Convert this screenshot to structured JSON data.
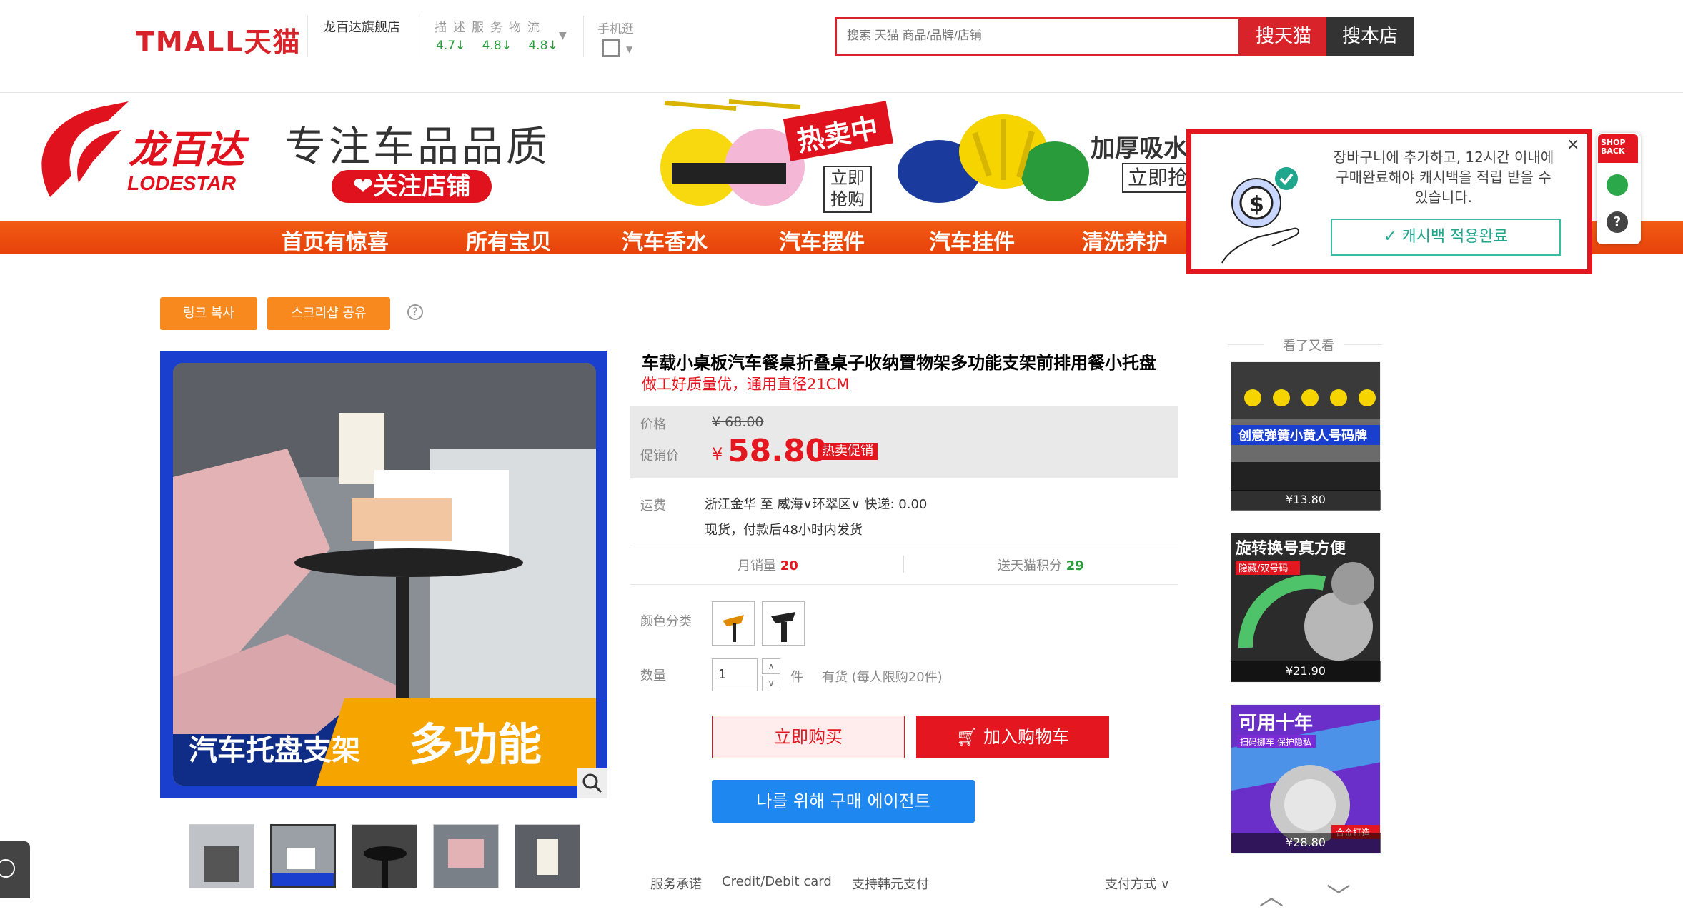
{
  "header": {
    "logo": "TMALL天猫",
    "shop_name": "龙百达旗舰店",
    "score_labels": "描述服务物流",
    "scores": "4.7↓ 4.8↓ 4.8↓",
    "mobile_label": "手机逛",
    "search_placeholder": "搜索 天猫 商品/品牌/店铺",
    "search_tmall": "搜天猫",
    "search_shop": "搜本店"
  },
  "banner": {
    "brand_cn": "龙百达",
    "brand_en": "LODESTAR",
    "slogan": "专注车品品质",
    "follow": "❤关注店铺",
    "hot_sale": "热卖中",
    "buy_now": "立即抢购",
    "thick_text": "加厚吸水",
    "buy_now_2": "立即抢"
  },
  "nav": [
    "首页有惊喜",
    "所有宝贝",
    "汽车香水",
    "汽车摆件",
    "汽车挂件",
    "清洗养护"
  ],
  "cashback": {
    "message": "장바구니에 추가하고, 12시간 이내에 구매완료해야 캐시백을 적립 받을 수 있습니다.",
    "button": "캐시백 적용완료",
    "close": "×",
    "badge": "SHOP BACK"
  },
  "actions": {
    "copy_link": "링크 복사",
    "share_screenshot": "스크리샵 공유"
  },
  "gallery": {
    "overlay_left": "汽车托盘支架",
    "overlay_right": "多功能",
    "thumbs": 5
  },
  "product": {
    "title": "车载小桌板汽车餐桌折叠桌子收纳置物架多功能支架前排用餐小托盘",
    "subtitle": "做工好质量优，通用直径21CM",
    "price_label": "价格",
    "old_price": "¥ 68.00",
    "promo_label": "促销价",
    "currency": "¥",
    "promo_price": "58.80",
    "promo_tag": "热卖促销",
    "ship_label": "运费",
    "ship_text": "浙江金华 至 威海∨环翠区∨ 快递: 0.00",
    "stock_text": "现货，付款后48小时内发货",
    "sales_label": "月销量",
    "sales_value": "20",
    "points_label": "送天猫积分",
    "points_value": "29",
    "color_label": "颜色分类",
    "qty_label": "数量",
    "qty_value": "1",
    "qty_unit": "件",
    "stock_info": "有货  (每人限购20件)",
    "buy_now": "立即购买",
    "add_cart": "加入购物车",
    "agent": "나를 위해 구매 에이전트",
    "service_label": "服务承诺",
    "service_card": "Credit/Debit card",
    "service_krw": "支持韩元支付",
    "payment": "支付方式 ∨"
  },
  "sidebar": {
    "title": "看了又看",
    "items": [
      {
        "caption": "创意弹簧小黄人号码牌",
        "price": "¥13.80"
      },
      {
        "caption": "旋转换号真方便",
        "tag": "隐藏/双号码",
        "price": "¥21.90"
      },
      {
        "caption": "可用十年",
        "tag": "扫码挪车 保护隐私",
        "tag2": "合金打造",
        "price": "¥28.80"
      }
    ]
  },
  "colors": {
    "tmall_red": "#d8232a",
    "nav_orange": "#e6410a",
    "action_orange": "#f7891f",
    "agent_blue": "#1e87f0",
    "cashback_green": "#1fa68d"
  }
}
